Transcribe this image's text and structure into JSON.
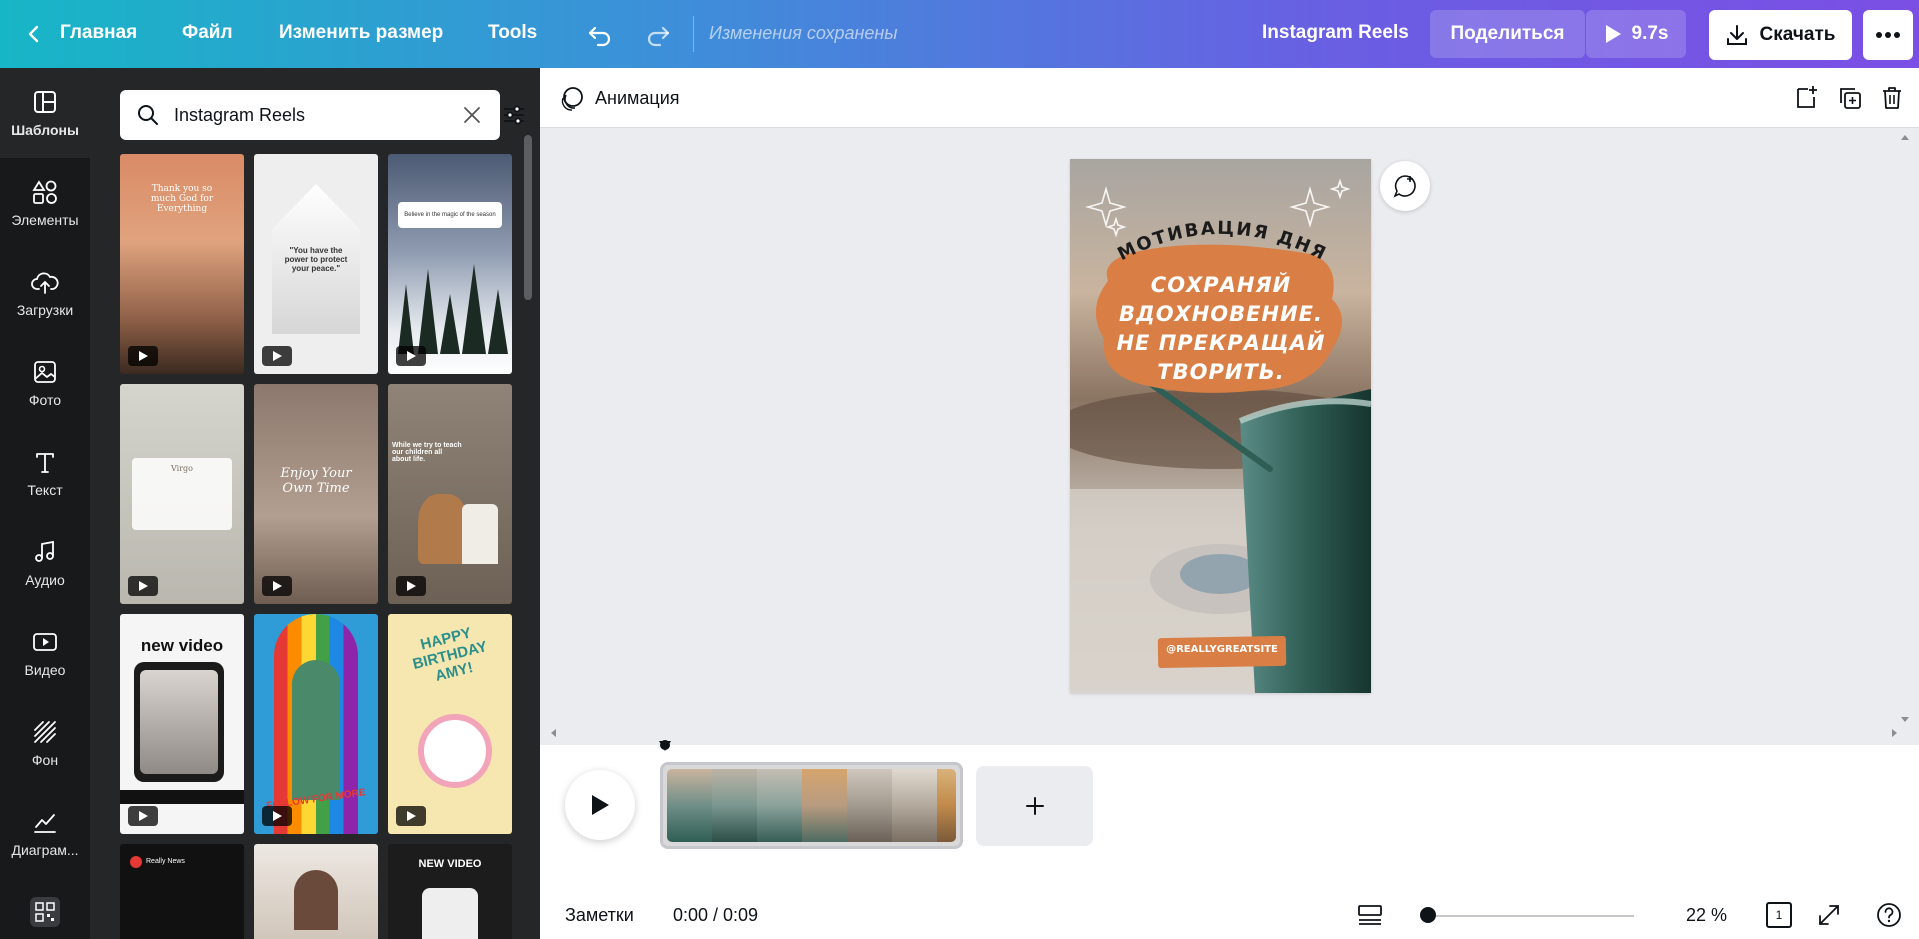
{
  "topbar": {
    "home": "Главная",
    "file": "Файл",
    "resize": "Изменить размер",
    "tools": "Tools",
    "saved_status": "Изменения сохранены",
    "doc_name": "Instagram Reels",
    "share": "Поделиться",
    "duration": "9.7s",
    "download": "Скачать"
  },
  "sidebar": {
    "items": [
      {
        "label": "Шаблоны",
        "icon": "templates-icon"
      },
      {
        "label": "Элементы",
        "icon": "elements-icon"
      },
      {
        "label": "Загрузки",
        "icon": "upload-cloud-icon"
      },
      {
        "label": "Фото",
        "icon": "photo-icon"
      },
      {
        "label": "Текст",
        "icon": "text-icon"
      },
      {
        "label": "Аудио",
        "icon": "music-note-icon"
      },
      {
        "label": "Видео",
        "icon": "video-icon"
      },
      {
        "label": "Фон",
        "icon": "background-stripes-icon"
      },
      {
        "label": "Диаграм...",
        "icon": "chart-line-icon"
      }
    ]
  },
  "panel": {
    "search_value": "Instagram Reels",
    "templates": [
      {
        "name": "sunset-grass",
        "text": "Thank you so much God for Everything",
        "bg": "#c98a66"
      },
      {
        "name": "power-quote",
        "text": "\"You have the power to protect your peace.\"",
        "bg": "#e9e9e9"
      },
      {
        "name": "winter-forest",
        "text": "Believe in the magic of the season",
        "bg": "#5b6a80"
      },
      {
        "name": "virgo",
        "text": "Virgo",
        "bg": "#c9c7c0"
      },
      {
        "name": "enjoy-your-own-time",
        "text": "Enjoy Your Own Time",
        "bg": "#8e7b70"
      },
      {
        "name": "child-learning",
        "text": "While we try to teach our children all about life.",
        "bg": "#8d7f72"
      },
      {
        "name": "new-video-noodles",
        "text": "new video",
        "bg": "#f5f5f5"
      },
      {
        "name": "follow-for-more",
        "text": "FOLLOW FOR MORE",
        "bg": "#f2b547"
      },
      {
        "name": "happy-birthday",
        "text": "HAPPY BIRTHDAY AMY!",
        "bg": "#f6e7b0"
      },
      {
        "name": "really-news",
        "text": "Really News",
        "bg": "#111111"
      },
      {
        "name": "woman-portrait",
        "text": "",
        "bg": "#e9e4de"
      },
      {
        "name": "new-video-dark",
        "text": "NEW VIDEO",
        "bg": "#1c1c1c"
      }
    ]
  },
  "editor": {
    "animation_label": "Анимация",
    "design": {
      "headline": "МОТИВАЦИЯ ДНЯ",
      "quote_lines": [
        "СОХРАНЯЙ",
        "ВДОХНОВЕНИЕ.",
        "НЕ ПРЕКРАЩАЙ",
        "ТВОРИТЬ."
      ],
      "handle": "@REALLYGREATSITE"
    }
  },
  "timeline": {
    "frames": 7
  },
  "footer": {
    "notes": "Заметки",
    "time": "0:00 / 0:09",
    "zoom": "22 %",
    "page_count": "1"
  },
  "colors": {
    "accent_orange": "#d97e44",
    "panel_bg": "#252627",
    "rail_bg": "#18191b"
  }
}
